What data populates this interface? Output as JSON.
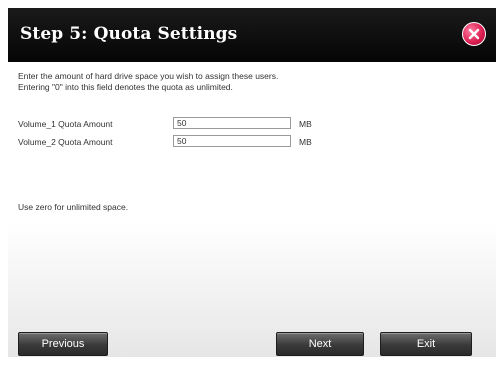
{
  "dialog": {
    "title": "Step 5: Quota Settings",
    "close_icon": "close-icon",
    "close_color": "#d81b4f"
  },
  "intro": {
    "line1": "Enter the amount of hard drive space you wish to assign these users.",
    "line2": "Entering \"0\" into this field denotes the quota as unlimited."
  },
  "fields": [
    {
      "label": "Volume_1 Quota Amount",
      "value": "50",
      "unit": "MB"
    },
    {
      "label": "Volume_2 Quota Amount",
      "value": "50",
      "unit": "MB"
    }
  ],
  "hint": "Use zero for unlimited space.",
  "buttons": {
    "previous": "Previous",
    "next": "Next",
    "exit": "Exit"
  }
}
